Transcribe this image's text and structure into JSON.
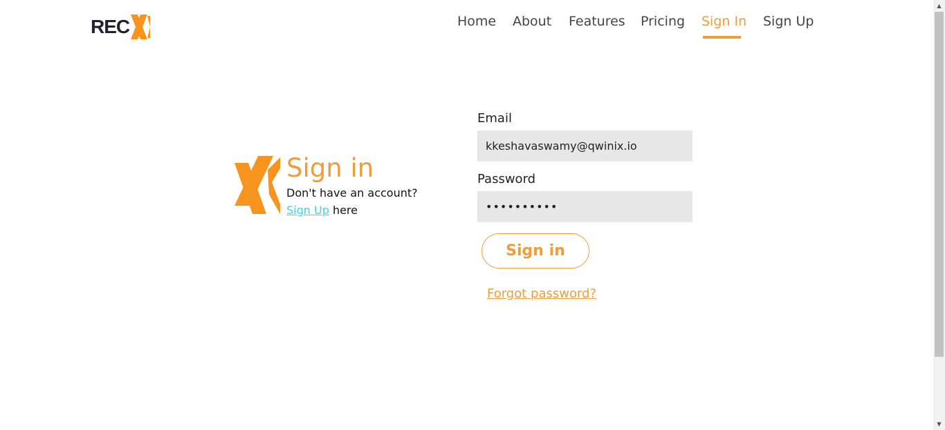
{
  "brand": {
    "logo_text": "REC",
    "accent": "#ef9c3a",
    "dark": "#1f2233"
  },
  "nav": {
    "items": [
      {
        "label": "Home"
      },
      {
        "label": "About"
      },
      {
        "label": "Features"
      },
      {
        "label": "Pricing"
      },
      {
        "label": "Sign In"
      },
      {
        "label": "Sign Up"
      }
    ],
    "active": "Sign In"
  },
  "signin": {
    "title": "Sign in",
    "no_account": "Don't have an account?",
    "signup_link": "Sign Up",
    "signup_suffix": " here"
  },
  "form": {
    "email_label": "Email",
    "email_value": "kkeshavaswamy@qwinix.io",
    "password_label": "Password",
    "password_value": "••••••••••",
    "submit_label": "Sign in",
    "forgot_label": "Forgot password?"
  },
  "icons": {
    "logo_mark": "x-logo-icon",
    "scroll_up": "scroll-up-arrow-icon",
    "scroll_down": "scroll-down-arrow-icon"
  }
}
